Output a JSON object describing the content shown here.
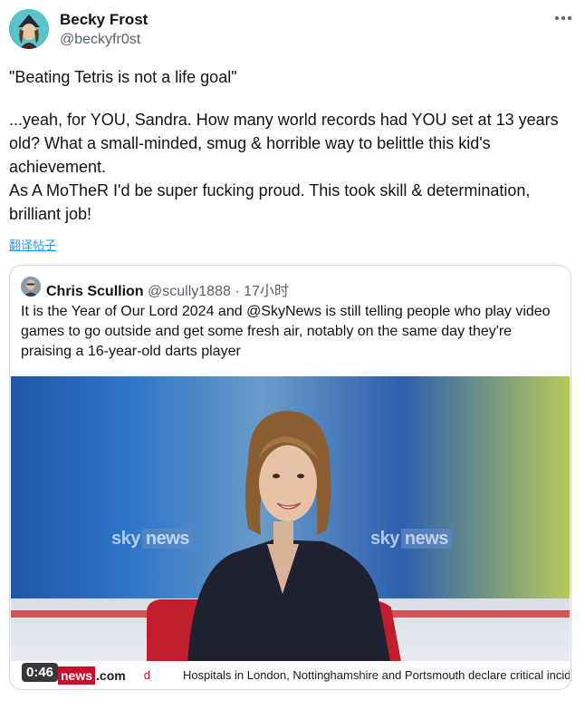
{
  "author": {
    "display_name": "Becky Frost",
    "handle": "@beckyfr0st"
  },
  "tweet": {
    "quote_line": "\"Beating Tetris is not a life goal\"",
    "paragraph_1": "...yeah, for YOU, Sandra. How many world records had YOU set at 13 years old? What a small-minded, smug & horrible way to belittle this kid's achievement.",
    "paragraph_2": "As A MoTheR I'd be super fucking proud. This took skill & determination, brilliant job!",
    "translate_label": "翻译帖子"
  },
  "quoted_tweet": {
    "display_name": "Chris Scullion",
    "handle": "@scully1888",
    "separator": "·",
    "time": "17小时",
    "text": "It is the Year of Our Lord 2024 and @SkyNews is still telling people who play video games to go outside and get some fresh air, notably on the same day they're praising a 16-year-old darts player"
  },
  "video": {
    "duration": "0:46",
    "logo_left_sky": "sky",
    "logo_left_news": "news",
    "logo_right_sky": "sky",
    "logo_right_news": "news",
    "ticker_news": "news",
    "ticker_dotcom": ".com",
    "ticker_d": "d",
    "ticker_headline": "Hospitals in London, Nottinghamshire and Portsmouth declare critical incidents a"
  },
  "colors": {
    "accent": "#1d9bf0",
    "secondary_text": "#536471",
    "border": "#cfd9de",
    "sky_red": "#c8102e"
  },
  "icons": {
    "more": "more-horizontal-icon"
  }
}
